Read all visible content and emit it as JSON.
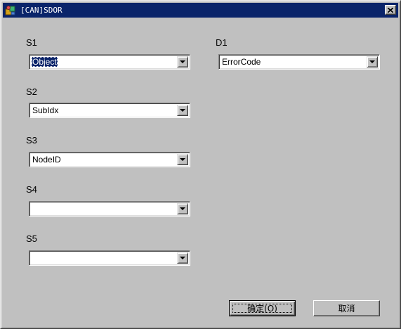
{
  "window": {
    "title": "[CAN]SDOR",
    "app_icon": "app-icon",
    "close_icon": "close-icon"
  },
  "fields": {
    "s1": {
      "label": "S1",
      "value": "Object",
      "selected": true
    },
    "s2": {
      "label": "S2",
      "value": "SubIdx"
    },
    "s3": {
      "label": "S3",
      "value": "NodeID"
    },
    "s4": {
      "label": "S4",
      "value": ""
    },
    "s5": {
      "label": "S5",
      "value": ""
    },
    "d1": {
      "label": "D1",
      "value": "ErrorCode"
    }
  },
  "buttons": {
    "ok_label": "确定(O)",
    "cancel_label": "取消"
  },
  "colors": {
    "titlebar": "#0a246a",
    "face": "#c0c0c0",
    "selection": "#0a246a"
  }
}
